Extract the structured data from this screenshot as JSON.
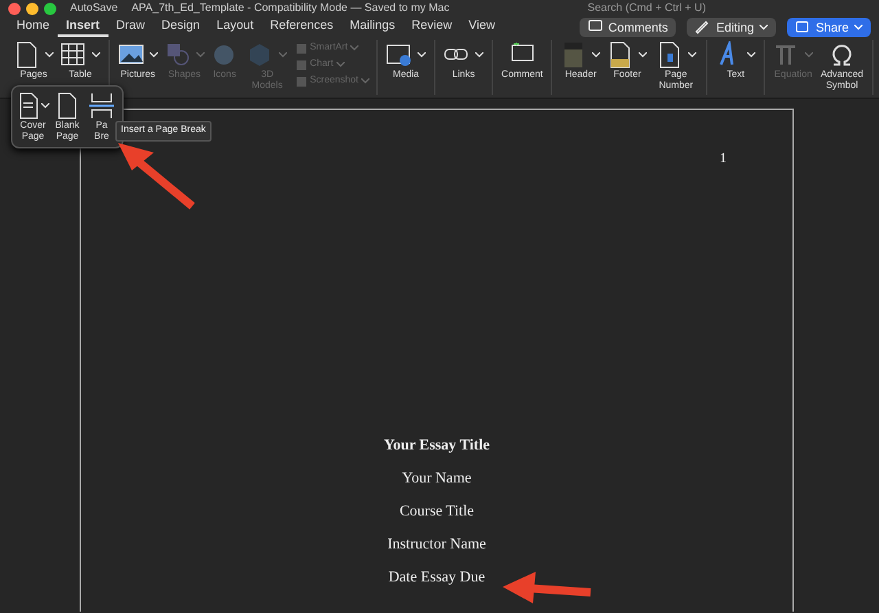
{
  "title_bar": {
    "autosave": "AutoSave",
    "document_title": "APA_7th_Ed_Template  -  Compatibility Mode — Saved to my Mac",
    "search_placeholder": "Search (Cmd + Ctrl + U)"
  },
  "tabs": [
    {
      "label": "Home",
      "selected": false
    },
    {
      "label": "Insert",
      "selected": true
    },
    {
      "label": "Draw",
      "selected": false
    },
    {
      "label": "Design",
      "selected": false
    },
    {
      "label": "Layout",
      "selected": false
    },
    {
      "label": "References",
      "selected": false
    },
    {
      "label": "Mailings",
      "selected": false
    },
    {
      "label": "Review",
      "selected": false
    },
    {
      "label": "View",
      "selected": false
    }
  ],
  "top_buttons": [
    {
      "kind": "comments",
      "label": "Comments"
    },
    {
      "kind": "editing",
      "label": "Editing"
    },
    {
      "kind": "share",
      "label": "Share"
    }
  ],
  "ribbon_groups": [
    {
      "items": [
        {
          "kind": "large",
          "label": "Pages",
          "disabled": false,
          "dropdown": true
        },
        {
          "kind": "large",
          "label": "Table",
          "disabled": false,
          "dropdown": true
        }
      ]
    },
    {
      "items": [
        {
          "kind": "large",
          "label": "Pictures",
          "disabled": false,
          "dropdown": true
        },
        {
          "kind": "large",
          "label": "Shapes",
          "disabled": true,
          "dropdown": true
        },
        {
          "kind": "large",
          "label": "Icons",
          "disabled": true,
          "dropdown": false
        },
        {
          "kind": "large",
          "label": "3D Models",
          "disabled": true,
          "dropdown": true
        },
        {
          "kind": "small",
          "label": "SmartArt",
          "disabled": true,
          "dropdown": true
        },
        {
          "kind": "small",
          "label": "Chart",
          "disabled": true,
          "dropdown": true
        },
        {
          "kind": "small",
          "label": "Screenshot",
          "disabled": true,
          "dropdown": true
        }
      ]
    },
    {
      "items": [
        {
          "kind": "large",
          "label": "Media",
          "disabled": false,
          "dropdown": true
        }
      ]
    },
    {
      "items": [
        {
          "kind": "large",
          "label": "Links",
          "disabled": false,
          "dropdown": true
        }
      ]
    },
    {
      "items": [
        {
          "kind": "large",
          "label": "Comment",
          "disabled": false,
          "dropdown": false
        }
      ]
    },
    {
      "items": [
        {
          "kind": "large",
          "label": "Header",
          "disabled": false,
          "dropdown": true
        },
        {
          "kind": "large",
          "label": "Footer",
          "disabled": false,
          "dropdown": true
        },
        {
          "kind": "large",
          "label": "Page Number",
          "disabled": false,
          "dropdown": true
        }
      ]
    },
    {
      "items": [
        {
          "kind": "large",
          "label": "Text",
          "disabled": false,
          "dropdown": true
        }
      ]
    },
    {
      "items": [
        {
          "kind": "large",
          "label": "Equation",
          "disabled": true,
          "dropdown": true
        },
        {
          "kind": "large",
          "label": "Advanced Symbol",
          "disabled": false,
          "dropdown": false
        }
      ]
    }
  ],
  "pages_menu": {
    "items": [
      {
        "label": "Cover Page",
        "dropdown": true
      },
      {
        "label": "Blank Page",
        "dropdown": false
      },
      {
        "label": "Pa Bre",
        "dropdown": false
      }
    ],
    "tooltip": "Insert a Page Break"
  },
  "document": {
    "page_number": "1",
    "lines": [
      {
        "text": "Your Essay Title",
        "bold": true
      },
      {
        "text": "Your Name",
        "bold": false
      },
      {
        "text": "Course Title",
        "bold": false
      },
      {
        "text": "Instructor Name",
        "bold": false
      },
      {
        "text": "Date Essay Due",
        "bold": false
      }
    ]
  }
}
